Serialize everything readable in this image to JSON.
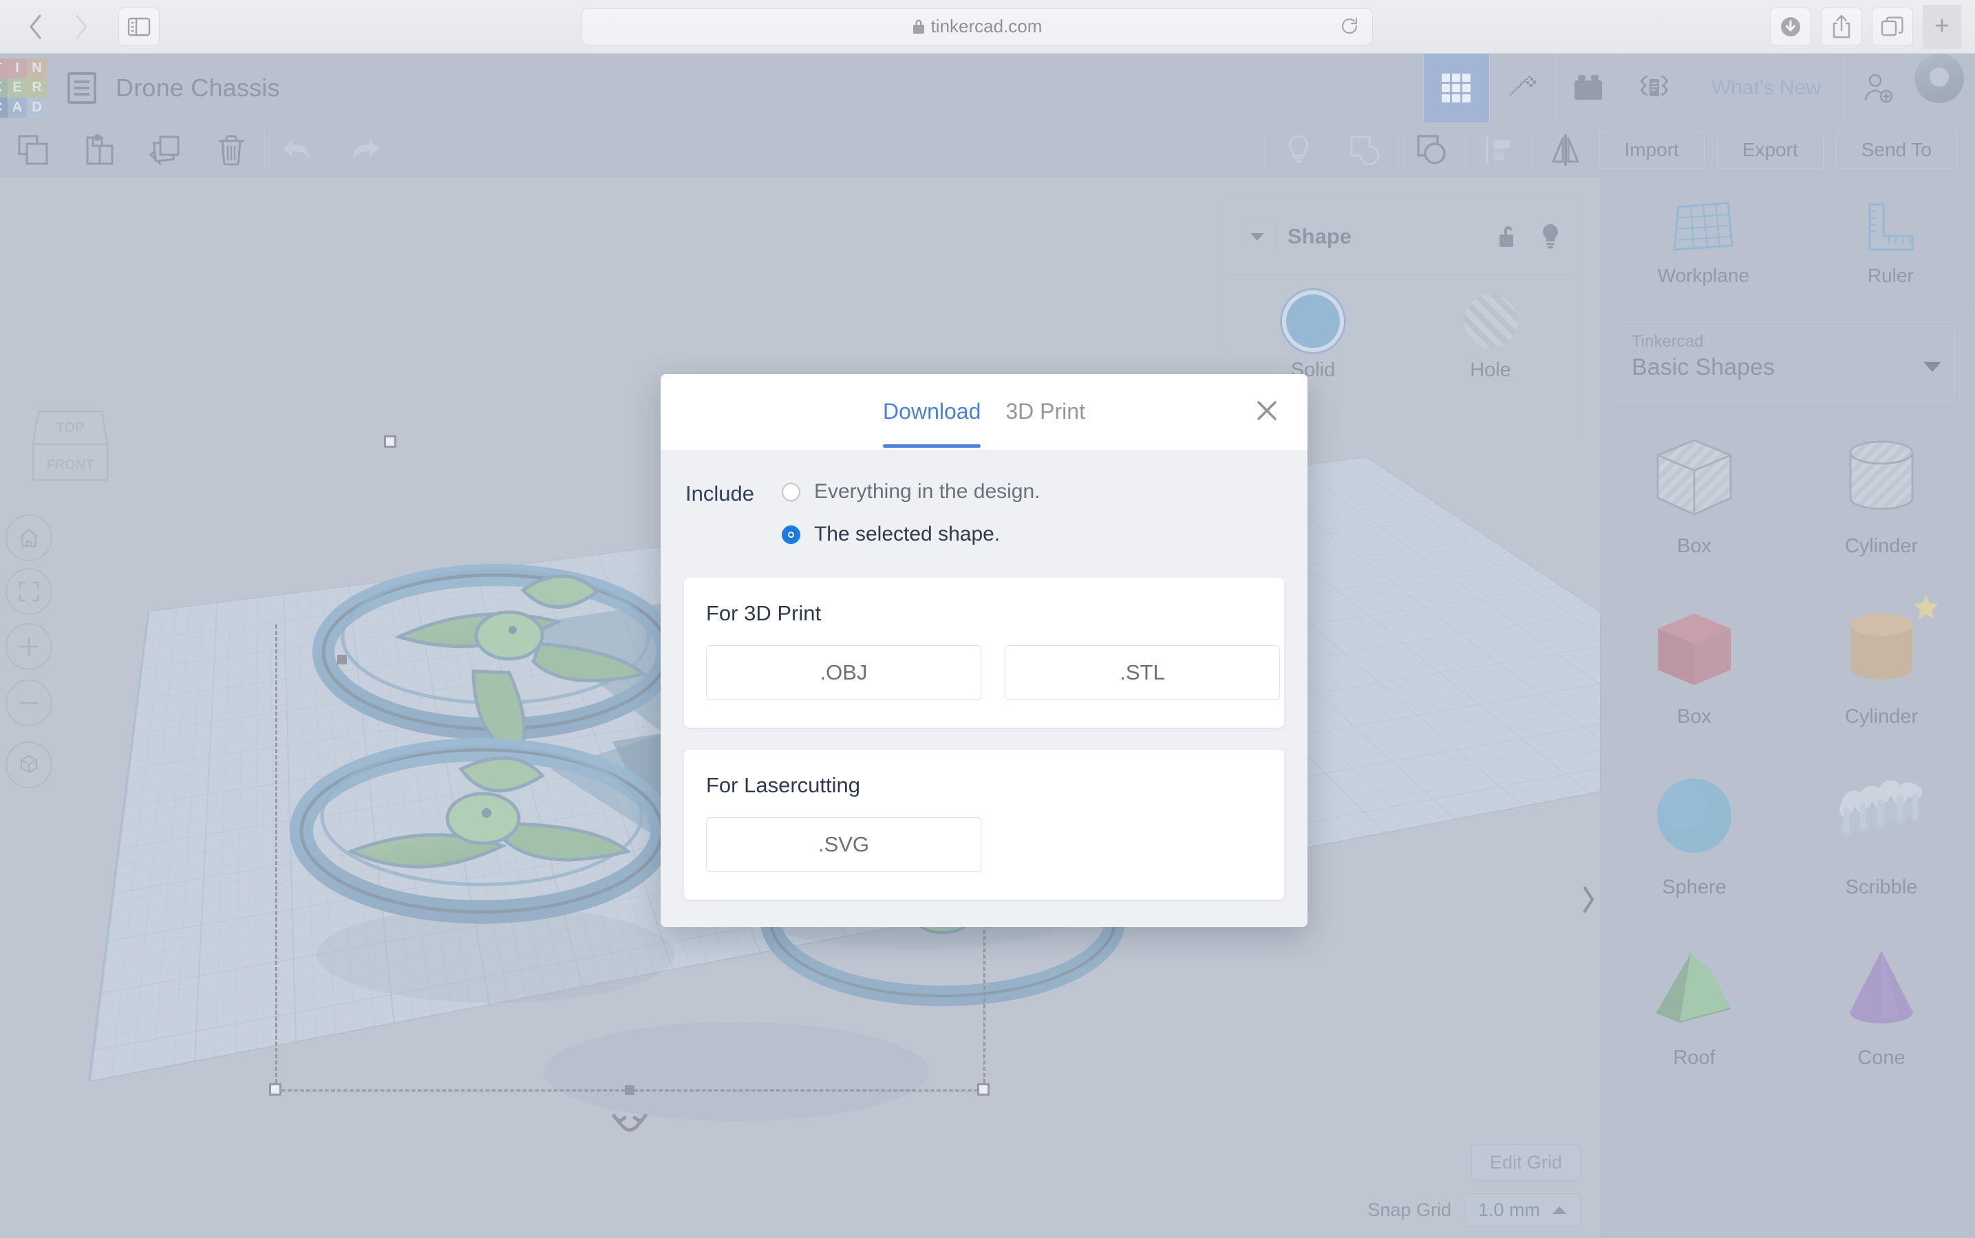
{
  "browser": {
    "url": "tinkercad.com",
    "lock_icon": "lock-icon",
    "back_icon": "chevron-left-icon",
    "forward_icon": "chevron-right-icon",
    "sidebar_icon": "sidebar-toggle-icon",
    "reload_icon": "reload-icon",
    "downloads_icon": "downloads-icon",
    "share_icon": "share-icon",
    "tabs_icon": "tab-overview-icon",
    "newtab_icon": "plus-icon"
  },
  "header": {
    "logo_letters": [
      "T",
      "I",
      "N",
      "K",
      "E",
      "R",
      "C",
      "A",
      "D"
    ],
    "doc_icon": "design-list-icon",
    "title": "Drone Chassis",
    "tools": [
      {
        "name": "gallery-icon",
        "label": "3D Designs",
        "active": true
      },
      {
        "name": "minecraft-pickaxe-icon",
        "label": "Minecraft",
        "active": false
      },
      {
        "name": "brick-icon",
        "label": "Bricks",
        "active": false
      },
      {
        "name": "codeblocks-icon",
        "label": "Codeblocks",
        "active": false
      }
    ],
    "whats_new": "What's New",
    "invite_icon": "add-person-icon",
    "avatar": "user-avatar"
  },
  "toolbar": {
    "left_icons": [
      {
        "name": "copy-icon",
        "dim": false
      },
      {
        "name": "paste-icon",
        "dim": false
      },
      {
        "name": "duplicate-icon",
        "dim": false
      },
      {
        "name": "delete-icon",
        "dim": false
      },
      {
        "name": "undo-icon",
        "dim": true
      },
      {
        "name": "redo-icon",
        "dim": true
      }
    ],
    "mid_icons": [
      {
        "name": "notes-lightbulb-icon",
        "dim": true
      },
      {
        "name": "group-icon",
        "dim": true
      },
      {
        "name": "ungroup-icon",
        "dim": false
      },
      {
        "name": "align-icon",
        "dim": true
      },
      {
        "name": "mirror-icon",
        "dim": false
      }
    ],
    "actions": [
      "Import",
      "Export",
      "Send To"
    ]
  },
  "viewport": {
    "view_cube": {
      "top_label": "TOP",
      "front_label": "FRONT"
    },
    "nav_buttons": [
      {
        "name": "home-view-icon"
      },
      {
        "name": "fit-to-view-icon"
      },
      {
        "name": "zoom-in-icon"
      },
      {
        "name": "zoom-out-icon"
      },
      {
        "name": "orthographic-toggle-icon"
      }
    ],
    "collapse_icon": "chevron-right-icon",
    "rotate_icon": "rotate-handle-icon",
    "edit_grid": "Edit Grid",
    "snap_grid_label": "Snap Grid",
    "snap_grid_value": "1.0 mm",
    "snap_caret": "caret-up-icon"
  },
  "shape_panel": {
    "collapse_icon": "caret-down-icon",
    "title": "Shape",
    "lock_icon": "unlocked-padlock-icon",
    "hint_icon": "lightbulb-icon",
    "swatches": [
      {
        "label": "Solid",
        "kind": "solid",
        "color": "#2a79ad",
        "selected": true
      },
      {
        "label": "Hole",
        "kind": "hole",
        "color": "#9aa6b6",
        "selected": false
      }
    ]
  },
  "sidebar": {
    "tools": [
      {
        "label": "Workplane",
        "icon": "workplane-icon"
      },
      {
        "label": "Ruler",
        "icon": "ruler-icon"
      }
    ],
    "library": {
      "collection": "Tinkercad",
      "category": "Basic Shapes",
      "caret_icon": "caret-down-icon"
    },
    "shapes": [
      {
        "label": "Box",
        "icon": "box-hole-thumb",
        "starred": false
      },
      {
        "label": "Cylinder",
        "icon": "cylinder-hole-thumb",
        "starred": false
      },
      {
        "label": "Box",
        "icon": "box-solid-thumb",
        "starred": false
      },
      {
        "label": "Cylinder",
        "icon": "cylinder-solid-thumb",
        "starred": true
      },
      {
        "label": "Sphere",
        "icon": "sphere-thumb",
        "starred": false
      },
      {
        "label": "Scribble",
        "icon": "scribble-thumb",
        "starred": false
      },
      {
        "label": "Roof",
        "icon": "roof-thumb",
        "starred": false
      },
      {
        "label": "Cone",
        "icon": "cone-thumb",
        "starred": false
      }
    ]
  },
  "modal": {
    "tabs": [
      {
        "label": "Download",
        "active": true
      },
      {
        "label": "3D Print",
        "active": false
      }
    ],
    "close_icon": "close-icon",
    "include_label": "Include",
    "options": [
      {
        "label": "Everything in the design.",
        "selected": false
      },
      {
        "label": "The selected shape.",
        "selected": true
      }
    ],
    "sections": [
      {
        "title": "For 3D Print",
        "files": [
          ".OBJ",
          ".STL"
        ]
      },
      {
        "title": "For Lasercutting",
        "files": [
          ".SVG"
        ]
      }
    ]
  },
  "colors": {
    "brand_header": "#7b8aa0",
    "accent_blue": "#4a82d8",
    "active_tool": "#4a70ad",
    "radio_blue": "#1a7ae0",
    "star_gold": "#c9b04a"
  }
}
